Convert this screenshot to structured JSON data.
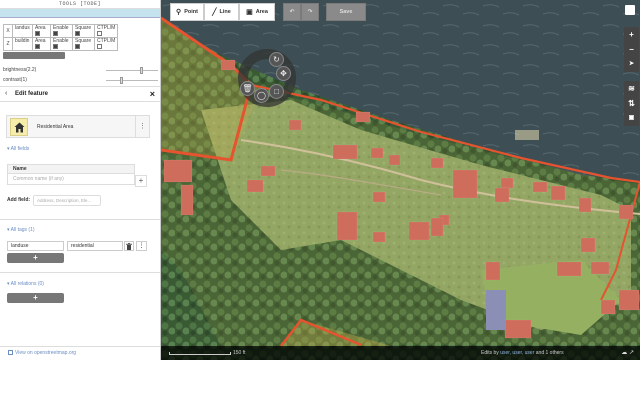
{
  "tools": {
    "title": "TOOLS [TODE]",
    "rows": [
      {
        "num": "X",
        "name": "landus",
        "area_label": "Area",
        "enable_label": "Enable",
        "square_label": "Square",
        "ctrl_label": "CTPL/M"
      },
      {
        "num": "Z",
        "name": "buildin",
        "area_label": "Area",
        "enable_label": "Enable",
        "square_label": "Square",
        "ctrl_label": "CTPL/M"
      }
    ],
    "brightness_label": "brightness(2.2)",
    "contrast_label": "contrast(1)"
  },
  "editor": {
    "back_icon": "‹",
    "title": "Edit feature",
    "close_icon": "×",
    "preset_name": "Residential Area",
    "preset_more": "⋮",
    "all_fields_title": "▾ All fields",
    "name_field_label": "Name",
    "name_placeholder": "Common name (if any)",
    "name_add": "+",
    "add_field_label": "Add field:",
    "add_field_placeholder": "Address, Description, Ele...",
    "all_tags_title": "▾ All tags (1)",
    "tag_key": "landuse",
    "tag_value": "residential",
    "tag_add": "+",
    "all_relations_title": "▾ All relations (0)",
    "relation_add": "+",
    "osm_link": "View on openstreetmap.org"
  },
  "toolbar": {
    "point_label": "Point",
    "line_label": "Line",
    "area_label": "Area",
    "undo_icon": "↶",
    "redo_icon": "↷",
    "save_label": "Save"
  },
  "map_controls": {
    "zoom_in": "+",
    "zoom_out": "−",
    "locate": "➤",
    "layers": "≋",
    "map_data": "⇅",
    "help": "▣"
  },
  "radial_menu": {
    "delete_icon": "🗑",
    "circularize_icon": "◯",
    "square_icon": "□",
    "move_icon": "✥",
    "rotate_icon": "↻",
    "disconnect_icon": "✂"
  },
  "footer": {
    "scale_label": "150 ft",
    "edits_prefix": "Edits by",
    "edits_users": "user, user, user",
    "edits_suffix": "and 1 others",
    "icons": "☁ ↗"
  },
  "colors": {
    "accent": "#6b8ec4",
    "area_outline": "#e5532f",
    "area_fill": "#c7b24a",
    "toolbar_bg": "#ffffff",
    "panel_divider": "#dddddd"
  }
}
